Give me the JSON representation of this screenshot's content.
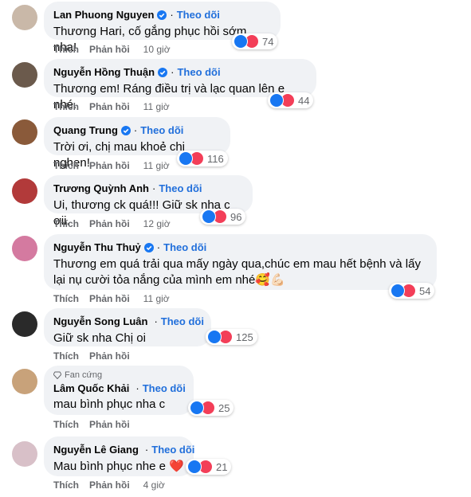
{
  "labels": {
    "follow": "Theo dõi",
    "like": "Thích",
    "reply": "Phản hồi",
    "fan_badge": "Fan cứng"
  },
  "comments": [
    {
      "name": "Lan Phuong Nguyen",
      "text": "Thương Hari, cố gắng phục hồi sớm nha!",
      "reactions": "74",
      "time": "10 giờ",
      "avatar_color": "#c9b8a8"
    },
    {
      "name": "Nguyễn Hồng Thuận",
      "text": "Thương em! Ráng điều trị và lạc quan lên e nhé.",
      "reactions": "44",
      "time": "11 giờ",
      "avatar_color": "#6b5a4c"
    },
    {
      "name": "Quang Trung",
      "text": "Trời ơi, chị mau khoẻ chị nghen!",
      "reactions": "116",
      "time": "11 giờ",
      "avatar_color": "#8a5a3a"
    },
    {
      "name": "Trương Quỳnh Anh",
      "text": "Ui, thương ck quá!!! Giữ sk nha c ơii.",
      "reactions": "96",
      "time": "12 giờ",
      "avatar_color": "#b23a3a"
    },
    {
      "name": "Nguyễn Thu Thuỷ",
      "text": "Thương em quá trải qua mấy ngày qua,chúc em mau hết bệnh và lấy lại nụ cười tỏa nắng của mình em nhé🥰💪🏻",
      "reactions": "54",
      "time": "11 giờ",
      "avatar_color": "#d47aa0"
    },
    {
      "name": "Nguyễn Song Luân",
      "text": "Giữ sk nha Chị oi",
      "reactions": "125",
      "time": "",
      "avatar_color": "#2a2a2a"
    },
    {
      "name": "Lâm Quốc Khải",
      "text": "mau bình phục nha c",
      "reactions": "25",
      "time": "",
      "avatar_color": "#c8a27a"
    },
    {
      "name": "Nguyễn Lê Giang",
      "text": "Mau bình phục nhe e ❤️",
      "reactions": "21",
      "time": "4 giờ",
      "avatar_color": "#d8c0c8"
    }
  ]
}
